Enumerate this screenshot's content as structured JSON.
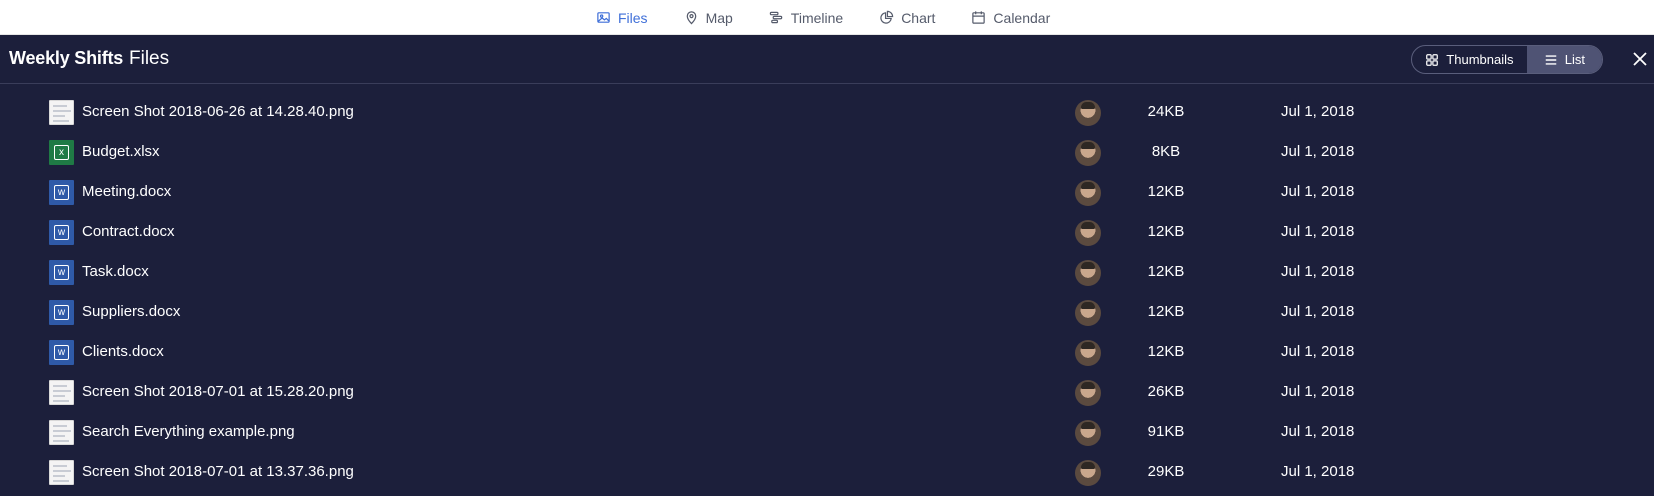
{
  "view_tabs": [
    {
      "label": "Files",
      "icon": "image-icon",
      "active": true
    },
    {
      "label": "Map",
      "icon": "map-pin-icon",
      "active": false
    },
    {
      "label": "Timeline",
      "icon": "timeline-icon",
      "active": false
    },
    {
      "label": "Chart",
      "icon": "pie-chart-icon",
      "active": false
    },
    {
      "label": "Calendar",
      "icon": "calendar-icon",
      "active": false
    }
  ],
  "header": {
    "board_title": "Weekly Shifts",
    "section_title": "Files",
    "toggle": {
      "thumbnails_label": "Thumbnails",
      "list_label": "List",
      "selected": "List"
    }
  },
  "files": [
    {
      "name": "Screen Shot 2018-06-26 at 14.28.40.png",
      "type": "image",
      "size": "24KB",
      "date": "Jul 1, 2018"
    },
    {
      "name": "Budget.xlsx",
      "type": "xlsx",
      "size": "8KB",
      "date": "Jul 1, 2018"
    },
    {
      "name": "Meeting.docx",
      "type": "docx",
      "size": "12KB",
      "date": "Jul 1, 2018"
    },
    {
      "name": "Contract.docx",
      "type": "docx",
      "size": "12KB",
      "date": "Jul 1, 2018"
    },
    {
      "name": "Task.docx",
      "type": "docx",
      "size": "12KB",
      "date": "Jul 1, 2018"
    },
    {
      "name": "Suppliers.docx",
      "type": "docx",
      "size": "12KB",
      "date": "Jul 1, 2018"
    },
    {
      "name": "Clients.docx",
      "type": "docx",
      "size": "12KB",
      "date": "Jul 1, 2018"
    },
    {
      "name": "Screen Shot 2018-07-01 at 15.28.20.png",
      "type": "image",
      "size": "26KB",
      "date": "Jul 1, 2018"
    },
    {
      "name": "Search Everything example.png",
      "type": "image",
      "size": "91KB",
      "date": "Jul 1, 2018"
    },
    {
      "name": "Screen Shot 2018-07-01 at 13.37.36.png",
      "type": "image",
      "size": "29KB",
      "date": "Jul 1, 2018"
    }
  ],
  "colors": {
    "page_bg": "#1c1f3b",
    "accent": "#3f6fd8",
    "excel": "#1f7a45",
    "word": "#2f5aa8"
  }
}
